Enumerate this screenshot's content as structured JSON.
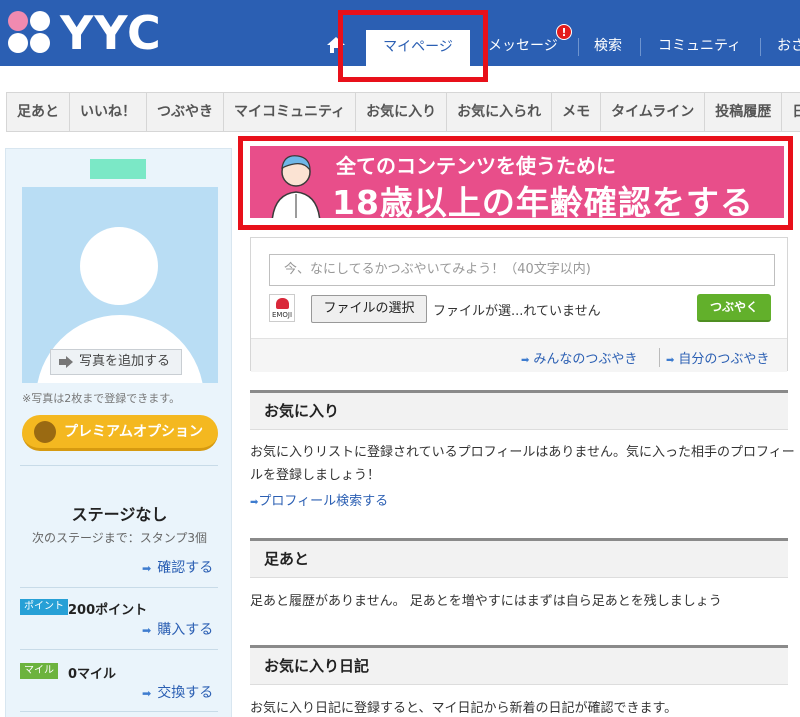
{
  "header": {
    "brand": "YYC",
    "nav": [
      {
        "label": "マイページ"
      },
      {
        "label": "メッセージ"
      },
      {
        "label": "検索"
      },
      {
        "label": "コミュニティ"
      },
      {
        "label": "おさ"
      }
    ],
    "message_badge": "!"
  },
  "subnav": [
    "足あと",
    "いいね！",
    "つぶやき",
    "マイコミュニティ",
    "お気に入り",
    "お気に入られ",
    "メモ",
    "タイムライン",
    "投稿履歴",
    "日"
  ],
  "sidebar": {
    "add_photo": "写真を追加する",
    "photo_note": "※写真は2枚まで登録できます。",
    "premium": "プレミアムオプション",
    "stage_title": "ステージなし",
    "stage_sub": "次のステージまで：スタンプ3個",
    "confirm_link": "確認する",
    "point_tag": "ポイント",
    "point_value": "200ポイント",
    "buy_link": "購入する",
    "mile_tag": "マイル",
    "mile_value": "0マイル",
    "exchange_link": "交換する"
  },
  "banner": {
    "line1": "全てのコンテンツを使うために",
    "line2": "18歳以上の年齢確認をする"
  },
  "post": {
    "placeholder": "今、なにしてるかつぶやいてみよう！（40文字以内)",
    "emoji_label": "EMOJI",
    "file_button": "ファイルの選択",
    "file_status": "ファイルが選...れていません",
    "submit": "つぶやく",
    "link_all": "みんなのつぶやき",
    "link_mine": "自分のつぶやき"
  },
  "sections": {
    "favorites": {
      "title": "お気に入り",
      "text": "お気に入りリストに登録されているプロフィールはありません。気に入った相手のプロフィールを登録しましょう！",
      "link": "プロフィール検索する"
    },
    "footprints": {
      "title": "足あと",
      "text": "足あと履歴がありません。 足あとを増やすにはまずは自ら足あとを残しましょう"
    },
    "diary": {
      "title": "お気に入り日記",
      "text": "お気に入り日記に登録すると、マイ日記から新着の日記が確認できます。"
    }
  },
  "colors": {
    "header_bg": "#2b5fb3",
    "highlight": "#e8101a",
    "banner_bg": "#e84e8a",
    "premium": "#f4b820",
    "tweet_button": "#62b02b"
  }
}
